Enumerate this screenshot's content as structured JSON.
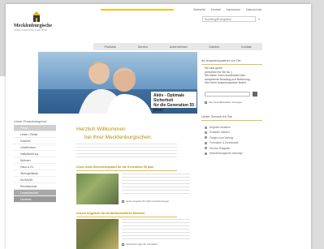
{
  "brand": {
    "name": "Mecklenburgische",
    "tagline": "VERSICHERUNGSGRUPPE"
  },
  "top_links": [
    "Startseite",
    "Kontakt",
    "Impressum",
    "Datenschutz"
  ],
  "search": {
    "placeholder": "Suchbegriff eingeben",
    "go_label": "»"
  },
  "nav": [
    "Produkte",
    "Service",
    "Unternehmen",
    "Karriere",
    "Kontakt"
  ],
  "hero": {
    "banner_line1": "Aktiv - Optimale Sicherheit",
    "banner_line2": "für die Generation 55 plus!"
  },
  "sidebar": {
    "title": "Unser Produktangebot",
    "items": [
      {
        "label": "Privat",
        "state": "active"
      },
      {
        "label": "Leben / Rente"
      },
      {
        "label": "Kranken"
      },
      {
        "label": "Unfall/Leben"
      },
      {
        "label": "Haftpflicht/Leg."
      },
      {
        "label": "Wohnen"
      },
      {
        "label": "Haus & Gr."
      },
      {
        "label": "Wohngebäude"
      },
      {
        "label": "Kfz/Kfz/W."
      },
      {
        "label": "Rechtsschutz"
      },
      {
        "label": "Landwirtschaft",
        "state": "dark"
      },
      {
        "label": "Gewerbe",
        "state": "darker"
      }
    ]
  },
  "welcome": {
    "line1": "Herzlich Willkommen",
    "line2": "bei Ihrer Mecklenburgischen."
  },
  "sections": {
    "aktiv_title": "Unser Aktiv-Sicherheitspaket für die Generation 55 plus",
    "aktiv_link": "Unser Angebot für Aktiv-Versicherungen",
    "betriebe_title": "Unsere Angebote für landwirtschaftliche Betriebe",
    "betriebe_link": "Versicherungen für Landwirte"
  },
  "right": {
    "ansprech_title": "Ihr Ansprechpartner vor Ort",
    "ansprech_line1": "Wir sind gerne",
    "ansprech_line2": "persönlich für Sie da :)",
    "ansprech_line3": "Wir bieten Ihnen bundesweit eine",
    "ansprech_line4": "kompetente Beratung und Betreuung.",
    "ansprech_line5": "Hier Ihren Ansprechpartner finden:",
    "plz_label": "Alle Geschäftsstellen anzeigen",
    "service_title": "Unser Service für Sie",
    "service_items": [
      "Angebot erstellen",
      "Schaden melden",
      "Fragen zum Vertrag",
      "Formulare & Downloads",
      "Service Ratgeber",
      "Mecklenburgische Vorsorge"
    ]
  },
  "colors": {
    "accent": "#e2c04a",
    "heading": "#b8900a",
    "nav_bg": "#e8e8e8"
  }
}
